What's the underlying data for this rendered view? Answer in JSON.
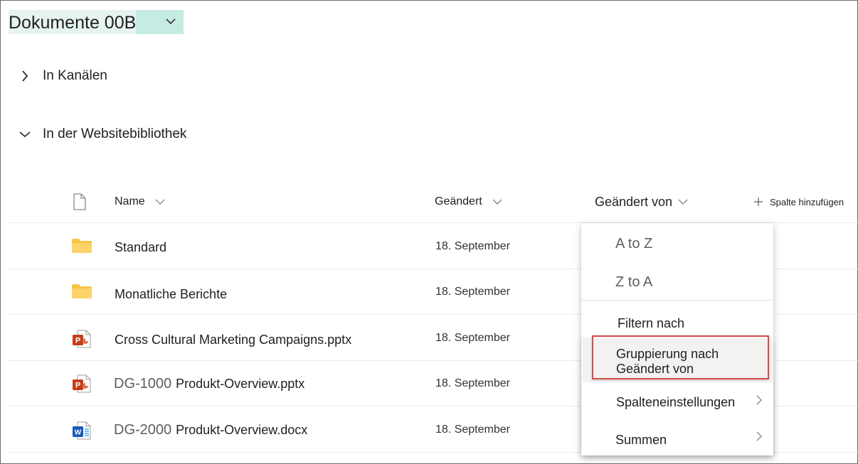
{
  "library": {
    "title": "Dokumente 00B"
  },
  "sections": {
    "channels": "In Kanälen",
    "site_library": "In der Websitebibliothek"
  },
  "columns": {
    "name": "Name",
    "modified": "Geändert",
    "modified_by": "Geändert von",
    "add_column": "Spalte hinzufügen"
  },
  "rows": [
    {
      "icon": "folder-icon",
      "prefix": "",
      "name": "Standard",
      "date": "18. September"
    },
    {
      "icon": "folder-icon",
      "prefix": "",
      "name": "Monatliche Berichte",
      "date": "18. September"
    },
    {
      "icon": "powerpoint-icon",
      "prefix": "",
      "name": "Cross Cultural Marketing Campaigns.pptx",
      "date": "18. September"
    },
    {
      "icon": "powerpoint-icon",
      "prefix": "DG-1000",
      "name": "Produkt-Overview.pptx",
      "date": "18. September"
    },
    {
      "icon": "word-icon",
      "prefix": "DG-2000",
      "name": "Produkt-Overview.docx",
      "date": "18. September"
    }
  ],
  "menu": {
    "sort_asc": "A to Z",
    "sort_desc": "Z to A",
    "filter": "Filtern nach",
    "group": "Gruppierung nach Geändert von",
    "column_settings": "Spalteneinstellungen",
    "totals": "Summen"
  },
  "colors": {
    "title_bg": "#e6f4f1",
    "title_chevron_bg": "#c5ece3",
    "highlight_border": "#d94a4a",
    "folder": "#f8c443",
    "powerpoint": "#c43e1c",
    "word": "#185abd"
  }
}
